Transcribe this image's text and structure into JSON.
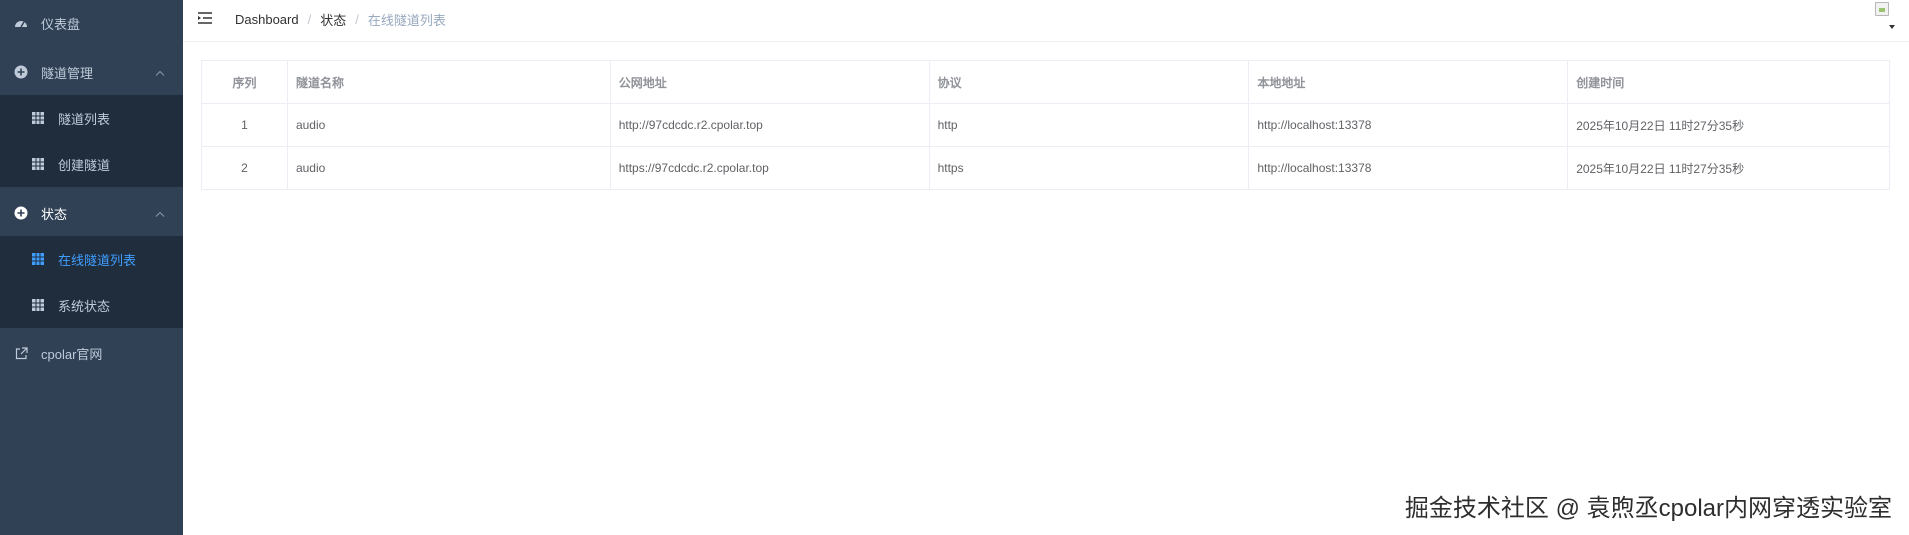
{
  "sidebar": {
    "items": [
      {
        "label": "仪表盘",
        "icon": "dashboard-icon"
      },
      {
        "label": "隧道管理",
        "icon": "plus-circle-icon"
      },
      {
        "label": "隧道列表",
        "icon": "grid-icon"
      },
      {
        "label": "创建隧道",
        "icon": "grid-icon"
      },
      {
        "label": "状态",
        "icon": "plus-circle-icon"
      },
      {
        "label": "在线隧道列表",
        "icon": "grid-icon"
      },
      {
        "label": "系统状态",
        "icon": "grid-icon"
      },
      {
        "label": "cpolar官网",
        "icon": "external-link-icon"
      }
    ]
  },
  "breadcrumb": [
    "Dashboard",
    "状态",
    "在线隧道列表"
  ],
  "table": {
    "headers": [
      "序列",
      "隧道名称",
      "公网地址",
      "协议",
      "本地地址",
      "创建时间"
    ],
    "rows": [
      [
        "1",
        "audio",
        "http://97cdcdc.r2.cpolar.top",
        "http",
        "http://localhost:13378",
        "2025年10月22日 11时27分35秒"
      ],
      [
        "2",
        "audio",
        "https://97cdcdc.r2.cpolar.top",
        "https",
        "http://localhost:13378",
        "2025年10月22日 11时27分35秒"
      ]
    ]
  },
  "watermark": "掘金技术社区 @ 袁煦丞cpolar内网穿透实验室",
  "colors": {
    "sidebar_bg": "#304156",
    "submenu_bg": "#1f2d3d",
    "active": "#409eff",
    "menu_text": "#bfcbd9"
  }
}
